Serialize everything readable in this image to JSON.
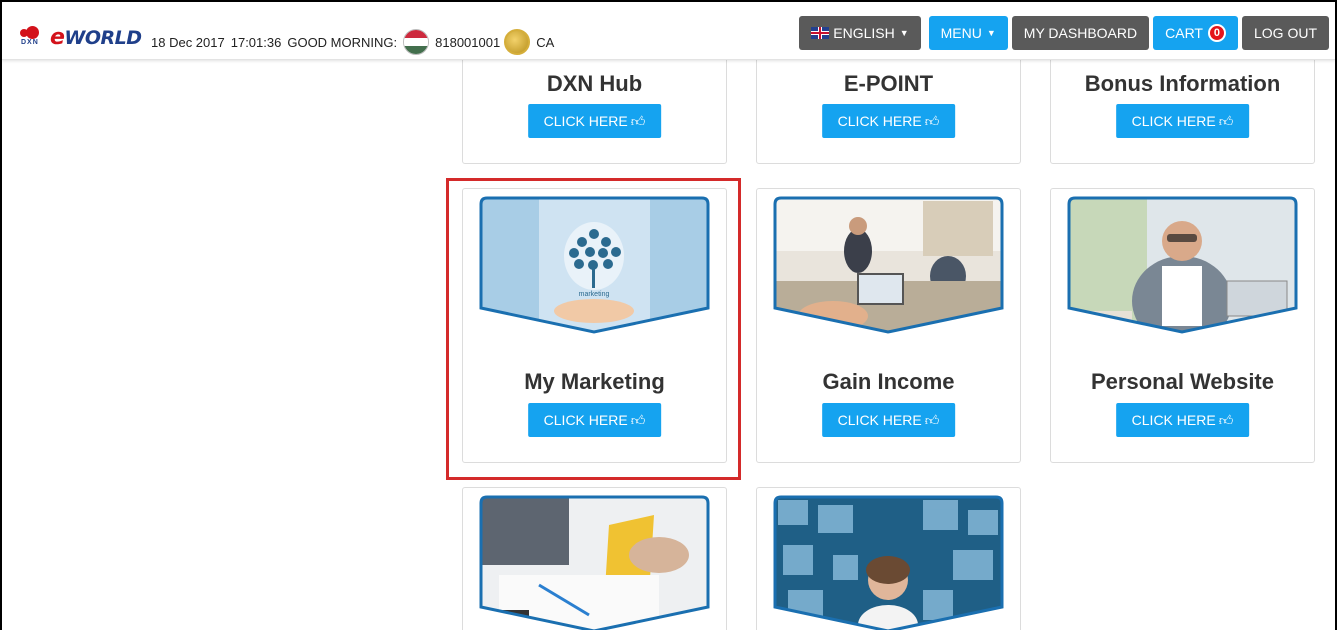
{
  "header": {
    "logo_text": "eWORLD",
    "logo_sub": "DXN",
    "date": "18 Dec 2017",
    "time": "17:01:36",
    "greeting": "GOOD MORNING:",
    "member_id": "818001001",
    "country": "CA"
  },
  "nav": {
    "language": "ENGLISH",
    "menu": "MENU",
    "dashboard": "MY DASHBOARD",
    "cart": "CART",
    "cart_count": "0",
    "logout": "LOG OUT"
  },
  "cards": [
    {
      "title": "DXN Hub",
      "button": "CLICK HERE"
    },
    {
      "title": "E-POINT",
      "button": "CLICK HERE"
    },
    {
      "title": "Bonus Information",
      "button": "CLICK HERE"
    },
    {
      "title": "My Marketing",
      "button": "CLICK HERE",
      "image_caption": "marketing"
    },
    {
      "title": "Gain Income",
      "button": "CLICK HERE"
    },
    {
      "title": "Personal Website",
      "button": "CLICK HERE"
    },
    {
      "title": "",
      "button": ""
    },
    {
      "title": "",
      "button": ""
    }
  ],
  "colors": {
    "accent": "#15a3f0",
    "nav_grey": "#5a5a5a",
    "highlight_border": "#d42a2a",
    "badge": "#e4141b"
  }
}
